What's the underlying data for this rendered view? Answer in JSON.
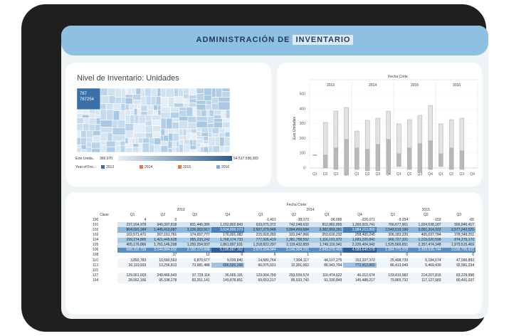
{
  "header": {
    "title_pre": "ADMINISTRACIÓN DE",
    "title_hl": "INVENTARIO"
  },
  "treemap": {
    "title": "Nivel de Inventario: Unidades",
    "top_label": "787",
    "top_value": "787254",
    "size_label": "Exis Unida..",
    "size_min": "366,970",
    "size_max": "54,517,598,383",
    "year_label": "Year of Fec..",
    "years": [
      {
        "label": "2013",
        "color": "#3b6fa8"
      },
      {
        "label": "2014",
        "color": "#e07a3f"
      },
      {
        "label": "2015",
        "color": "#e07a3f"
      },
      {
        "label": "2016",
        "color": "#7aaed6"
      }
    ]
  },
  "box_chart": {
    "header": "Fecha Corte",
    "ylabel": "Exis Unidades",
    "years": [
      "2013",
      "2014",
      "2015",
      "2016"
    ],
    "quarters": [
      "Q1",
      "Q2",
      "Q3",
      "Q4"
    ],
    "yticks": [
      "0",
      "100",
      "200",
      "300",
      "400",
      "500"
    ]
  },
  "table": {
    "header": "Fecha Corte",
    "col_label": "Clase",
    "years": [
      "2013",
      "2014",
      "2015"
    ],
    "quarters": [
      "Q1",
      "Q2",
      "Q3",
      "Q4",
      "Q1",
      "Q2",
      "Q3",
      "Q4",
      "Q1",
      "Q2",
      "Q3"
    ],
    "rows": [
      {
        "clase": "100",
        "cells": [
          "4",
          "0",
          "",
          "",
          "-1,401",
          "-38,070",
          "-96,095",
          "-220,071",
          "-9,254",
          "-153",
          "-65"
        ]
      },
      {
        "clase": "101",
        "cells": [
          "237,164,978",
          "940,397,818",
          "831,440,395",
          "1,152,802,843",
          "633,075,372",
          "742,048,632",
          "812,882,855",
          "1,260,915,741",
          "766,677,901",
          "1,024,538,187",
          "556,846,417"
        ]
      },
      {
        "clase": "102",
        "cells": [
          "864,091,184",
          "1,445,413,087",
          "3,126,353,917",
          "3,634,809,073",
          "2,507,379,948",
          "3,894,459,684",
          "3,382,893,391",
          "3,984,213,890",
          "2,543,519,196",
          "3,051,314,322",
          "2,577,242,525"
        ]
      },
      {
        "clase": "103",
        "cells": [
          "102,571,471",
          "267,151,761",
          "174,657,777",
          "176,001,082",
          "215,918,283",
          "331,047,966",
          "253,616,232",
          "258,400,245",
          "306,183,220",
          "405,037,784",
          "378,349,251"
        ]
      },
      {
        "clase": "104",
        "cells": [
          "299,274,865",
          "1,421,445,628",
          "955,233,242",
          "1,768,174,733",
          "777,926,419",
          "1,381,758,552",
          "1,116,101,972",
          "1,683,220,842",
          "966,727,331",
          "1,215,020,598",
          "874,275,170"
        ]
      },
      {
        "clase": "105",
        "cells": [
          "405,176,866",
          "1,761,146,298",
          "1,250,254,937",
          "1,861,897,531",
          "1,318,822,297",
          "2,119,432,859",
          "1,749,116,941",
          "2,226,404,942",
          "1,525,566,651",
          "2,357,474,348",
          "1,979,515,469"
        ]
      },
      {
        "clase": "106",
        "cells": [
          "688,392,739",
          "3,144,884,932",
          "2,150,173,668",
          "5,195,867,162",
          "2,073,204,044",
          "3,146,304,191",
          "2,943,079,456",
          "4,589,640,578",
          "1,984,779,378",
          "3,303,595,744",
          "3,036,795,631"
        ]
      },
      {
        "clase": "108",
        "cells": [
          "",
          "37",
          "12",
          "9",
          "6",
          "1",
          "6",
          "",
          "0",
          "",
          "0"
        ]
      },
      {
        "clase": "110",
        "cells": [
          "3,892,783",
          "10,680,563",
          "6,870,677",
          "9,039,840",
          "14,580,764",
          "7,994,117",
          "44,107,275",
          "152,327,373",
          "25,498,739",
          "5,184,574",
          "47,090,893"
        ]
      },
      {
        "clase": "113",
        "cells": [
          "20,119,933",
          "13,256,813",
          "73,081,488",
          "686,593,268",
          "66,075,931",
          "12,301,062",
          "86,943,794",
          "772,413,860",
          "86,413,049",
          "5,469,430",
          "92,581,234"
        ]
      },
      {
        "clase": "115",
        "cells": [
          "",
          "",
          "",
          "",
          "",
          "",
          "",
          "",
          "",
          "",
          ""
        ]
      },
      {
        "clase": "127",
        "cells": [
          "129,061,603",
          "249,466,543",
          "97,729,114",
          "36,665,191",
          "123,004,759",
          "293,559,574",
          "110,474,622",
          "46,012,674",
          "133,410,582",
          "214,207,816",
          "83,229,998"
        ]
      },
      {
        "clase": "194",
        "cells": [
          "28,062,166",
          "95,338,278",
          "83,251,141",
          "149,878,851",
          "69,653,217",
          "85,533,743",
          "91,330,849",
          "145,488,217",
          "79,865,732",
          "117,127,983",
          "80,491,037"
        ]
      }
    ]
  }
}
